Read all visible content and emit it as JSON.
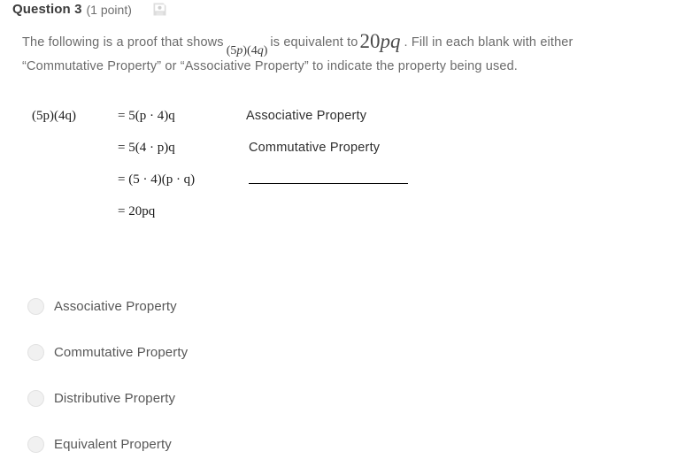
{
  "header": {
    "question_title": "Question 3",
    "points": "(1 point)",
    "save_icon": "save-icon"
  },
  "question": {
    "text_part_1": "The following is a proof that shows",
    "inline_math_open": "(5",
    "inline_math_p": "p",
    "inline_math_mid": ")(4",
    "inline_math_q": "q",
    "inline_math_close": ")",
    "text_part_2": "is equivalent to",
    "big_math_num": "20",
    "big_math_p": "p",
    "big_math_q": "q",
    "text_part_3": ". Fill in each blank with either “Commutative Property” or “Associative Property” to indicate the property being used."
  },
  "proof": {
    "lhs": "(5p)(4q)",
    "rows": [
      {
        "equation": "= 5(p · 4)q",
        "reason": "Associative Property",
        "is_blank": false
      },
      {
        "equation": "= 5(4 · p)q",
        "reason": "Commutative Property",
        "is_blank": false
      },
      {
        "equation": "= (5 · 4)(p · q)",
        "reason": "",
        "is_blank": true
      },
      {
        "equation": "= 20pq",
        "reason": "",
        "is_blank": false
      }
    ]
  },
  "options": [
    {
      "label": "Associative Property",
      "selected": false
    },
    {
      "label": "Commutative Property",
      "selected": false
    },
    {
      "label": "Distributive Property",
      "selected": false
    },
    {
      "label": "Equivalent Property",
      "selected": false
    }
  ],
  "colors": {
    "title_text": "#3b3b3b",
    "body_text": "#6b6b6b",
    "proof_text": "#1c1c1c",
    "option_text": "#575757",
    "radio_fill": "#f1f1f1",
    "radio_border": "#e2e2e2",
    "icon_gray": "#d8d8d8"
  }
}
